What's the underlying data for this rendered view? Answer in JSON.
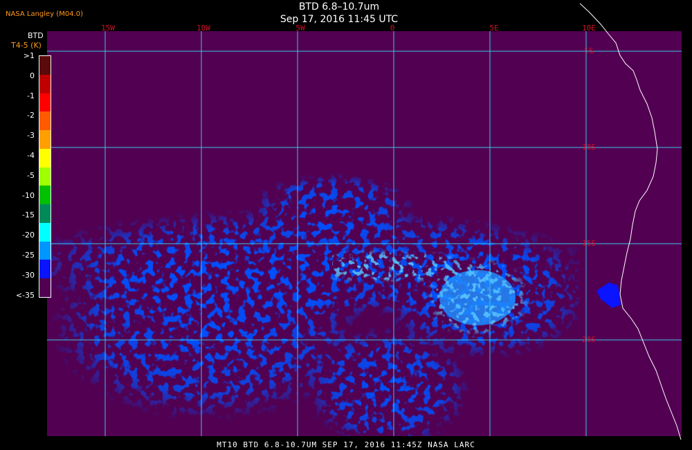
{
  "header": {
    "title": "BTD 6.8–10.7um",
    "datetime": "Sep 17, 2016 11:45 UTC",
    "credit": "NASA Langley (M04.0)"
  },
  "colorbar": {
    "title": "BTD",
    "unit": "T4-5 (K)",
    "labels": [
      ">1",
      "0",
      "-1",
      "-2",
      "-3",
      "-4",
      "-5",
      "-10",
      "-15",
      "-20",
      "-25",
      "-30",
      "<-35"
    ],
    "colors": [
      "#5a0a0a",
      "#c00000",
      "#ff0000",
      "#ff5a00",
      "#ffa000",
      "#ffff00",
      "#a0ff00",
      "#00c000",
      "#008a5a",
      "#00ffff",
      "#0096ff",
      "#0a14ff",
      "#520052"
    ]
  },
  "map": {
    "background": "#520052",
    "grid_color": "#38c8e8",
    "grid_label_color": "#d0102a",
    "lon_labels": [
      "15W",
      "10W",
      "5W",
      "0",
      "5E",
      "10E"
    ],
    "lat_labels": [
      "5S",
      "10S",
      "15S",
      "20S"
    ]
  },
  "footer": {
    "text": "MT10  BTD 6.8-10.7UM   SEP 17, 2016 11:45Z   NASA LARC"
  }
}
